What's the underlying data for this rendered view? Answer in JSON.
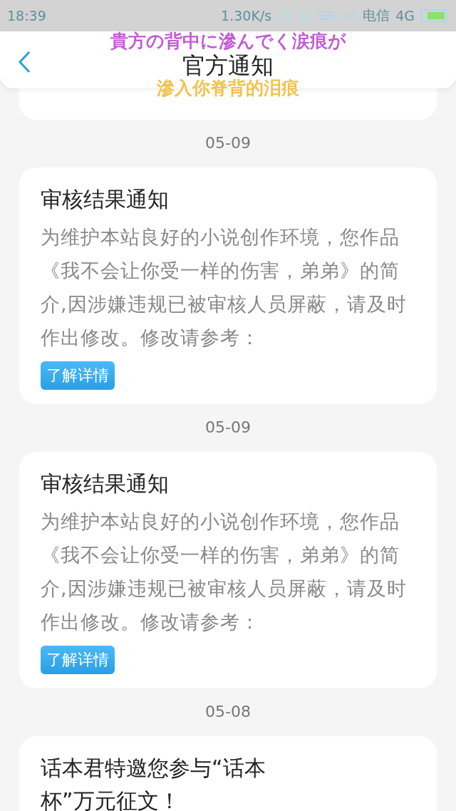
{
  "status_bar": {
    "time": "18:39",
    "speed": "1.30K/s",
    "carrier": "电信",
    "network": "4G"
  },
  "header": {
    "title": "官方通知"
  },
  "lyrics": [
    {
      "text": "貴方の背中に滲んでく涙痕が",
      "color": "#c35ad6"
    },
    {
      "text": "滲入你脊背的泪痕",
      "color": "#f2c24e"
    }
  ],
  "notices": [
    {
      "date": "05-09",
      "title": "审核结果通知",
      "body": "为维护本站良好的小说创作环境，您作品《我不会让你受一样的伤害，弟弟》的简介,因涉嫌违规已被审核人员屏蔽，请及时作出修改。修改请参考：",
      "button": "了解详情"
    },
    {
      "date": "05-09",
      "title": "审核结果通知",
      "body": "为维护本站良好的小说创作环境，您作品《我不会让你受一样的伤害，弟弟》的简介,因涉嫌违规已被审核人员屏蔽，请及时作出修改。修改请参考：",
      "button": "了解详情"
    },
    {
      "date": "05-08",
      "title": "话本君特邀您参与“话本杯”万元征文！"
    }
  ]
}
